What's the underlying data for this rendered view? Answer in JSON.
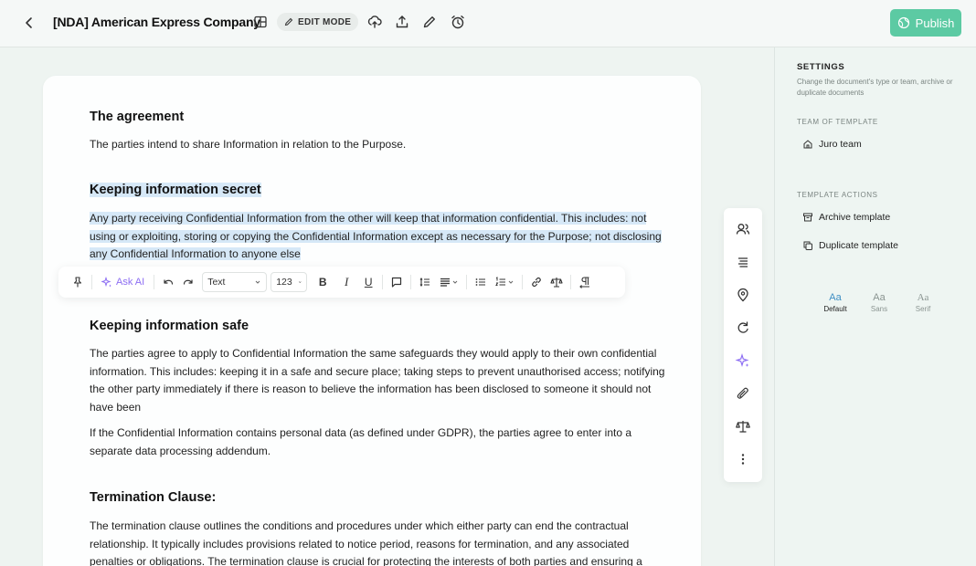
{
  "header": {
    "title": "[NDA] American Express Company",
    "edit_mode": "EDIT MODE",
    "publish": "Publish"
  },
  "document": {
    "sections": [
      {
        "heading": "The agreement",
        "paragraphs": [
          "The parties intend to share Information in relation to the Purpose."
        ]
      },
      {
        "heading": "Keeping information secret",
        "paragraphs": [
          "Any party receiving Confidential Information from the other will keep that information confidential. This includes: not using or exploiting, storing  or copying the Confidential Information except as necessary for the Purpose; not disclosing any Confidential Information to anyone else"
        ]
      },
      {
        "heading": "Keeping information safe",
        "paragraphs": [
          "The parties agree to apply to Confidential Information the same safeguards they would apply to their own confidential information. This includes: keeping it in a safe and secure place; taking steps to prevent unauthorised access; notifying the other party immediately if there is reason to believe the information has been disclosed to someone it should not have been",
          "If the Confidential Information contains personal data (as defined under GDPR), the parties agree to enter into a separate data processing addendum."
        ]
      },
      {
        "heading": "Termination Clause:",
        "paragraphs": [
          "The termination clause outlines the conditions and procedures under which either party can end the contractual relationship. It typically includes provisions related to notice period, reasons for termination, and any associated penalties or obligations. The termination clause is crucial for protecting the interests of both parties and ensuring a"
        ]
      }
    ]
  },
  "toolbar": {
    "ask_ai": "Ask AI",
    "text_style": "Text",
    "number_format": "123",
    "bold": "B",
    "italic": "I",
    "underline": "U"
  },
  "settings": {
    "title": "SETTINGS",
    "description": "Change the document's type or team, archive or duplicate documents",
    "team_label": "TEAM OF TEMPLATE",
    "team": "Juro team",
    "actions_label": "TEMPLATE ACTIONS",
    "archive": "Archive template",
    "duplicate": "Duplicate template",
    "fonts": [
      {
        "sample": "Aa",
        "name": "Default"
      },
      {
        "sample": "Aa",
        "name": "Sans"
      },
      {
        "sample": "Aa",
        "name": "Serif"
      }
    ]
  },
  "colors": {
    "accent": "#5ccaa3",
    "highlight": "#d6e8f7",
    "ai": "#8d6ef3"
  }
}
